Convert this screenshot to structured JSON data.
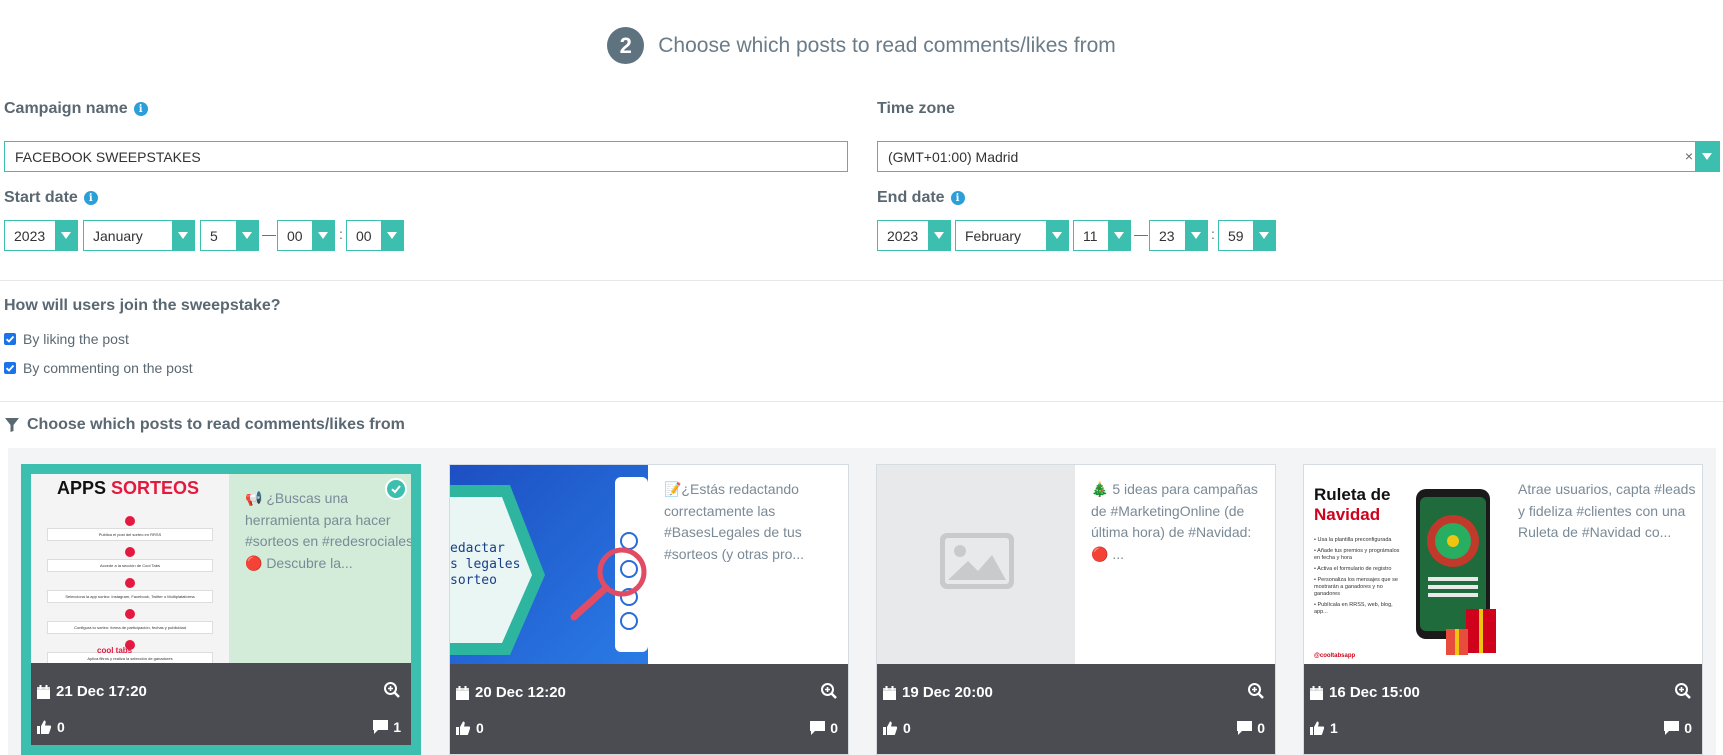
{
  "step": {
    "number": "2",
    "title": "Choose which posts to read comments/likes from"
  },
  "campaign": {
    "label": "Campaign name",
    "value": "FACEBOOK SWEEPSTAKES"
  },
  "timezone": {
    "label": "Time zone",
    "value": "(GMT+01:00) Madrid",
    "clear": "×"
  },
  "start_date": {
    "label": "Start date",
    "year": "2023",
    "month": "January",
    "day": "5",
    "hour": "00",
    "minute": "00"
  },
  "end_date": {
    "label": "End date",
    "year": "2023",
    "month": "February",
    "day": "11",
    "hour": "23",
    "minute": "59"
  },
  "separators": {
    "dash": "—",
    "colon": ":"
  },
  "join": {
    "question": "How will users join the sweepstake?",
    "options": [
      {
        "label": "By liking the post",
        "checked": true
      },
      {
        "label": "By commenting on the post",
        "checked": true
      }
    ]
  },
  "posts_section": {
    "title": "Choose which posts to read comments/likes from"
  },
  "posts": [
    {
      "selected": true,
      "caption": "📢 ¿Buscas una herramienta para hacer #sorteos en #redesrociales? 🔴 Descubre la...",
      "thumb_title_a": "APPS",
      "thumb_title_b": "SORTEOS",
      "thumb_steps": [
        "Publica el post del sorteo en RRSS",
        "Accede a la sección de Cool Tabs",
        "Selecciona la app sorteo: Instagram, Facebook, Twitter o Multiplataforma",
        "Configura tu sorteo: forma de participación, fechas y publicidad",
        "Aplica filtros y realiza la selección de ganadores"
      ],
      "thumb_brand": "cool tabs",
      "date": "21 Dec 17:20",
      "likes": "0",
      "comments": "1"
    },
    {
      "selected": false,
      "caption": "📝¿Estás redactando correctamente las #BasesLegales de tus #sorteos (y otras pro...",
      "thumb_text": [
        "edactar",
        "s legales",
        "sorteo"
      ],
      "date": "20 Dec 12:20",
      "likes": "0",
      "comments": "0"
    },
    {
      "selected": false,
      "caption": "🎄 5 ideas para campañas de #MarketingOnline (de última hora) de #Navidad: 🔴 ...",
      "date": "19 Dec 20:00",
      "likes": "0",
      "comments": "0"
    },
    {
      "selected": false,
      "caption": "Atrae usuarios, capta #leads y fideliza #clientes con una Ruleta de #Navidad co...",
      "thumb_title_a": "Ruleta de",
      "thumb_title_b": "Navidad",
      "thumb_bullets": [
        "Usa la plantilla preconfigurada",
        "Añade tus premios y prográmalos en fecha y hora",
        "Activa el formulario de registro",
        "Personaliza los mensajes que se mostrarán a ganadores y no ganadores",
        "Publícala en RRSS, web, blog, app..."
      ],
      "thumb_brand": "@cooltabsapp",
      "date": "16 Dec 15:00",
      "likes": "1",
      "comments": "0"
    }
  ],
  "colors": {
    "accent": "#3cbfae",
    "footer": "#4a4c52",
    "info": "#2a9fd8"
  }
}
